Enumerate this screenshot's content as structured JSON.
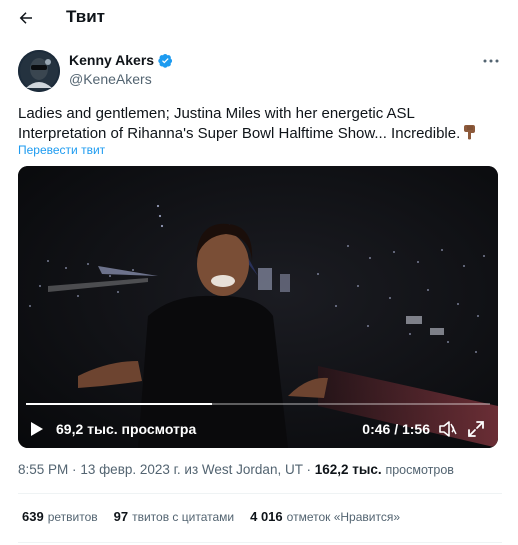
{
  "header": {
    "title": "Твит"
  },
  "author": {
    "name": "Kenny Akers",
    "handle": "@KeneAkers",
    "verified": true
  },
  "tweet": {
    "text": "Ladies and gentlemen; Justina Miles with her energetic ASL Interpretation of Rihanna's Super Bowl Halftime Show... Incredible.",
    "translate_label": "Перевести твит"
  },
  "video": {
    "views_label": "69,2 тыс. просмотра",
    "time_label": "0:46 / 1:56",
    "progress": 0.4
  },
  "meta": {
    "time": "8:55 PM",
    "sep1": "·",
    "date": "13 февр. 2023 г. из West Jordan, UT",
    "sep2": "·",
    "views_count": "162,2 тыс.",
    "views_word": "просмотров"
  },
  "stats": {
    "retweets_count": "639",
    "retweets_label": "ретвитов",
    "quotes_count": "97",
    "quotes_label": "твитов с цитатами",
    "likes_count": "4 016",
    "likes_label": "отметок «Нравится»"
  },
  "colors": {
    "text": "#0f1419",
    "secondary": "#536471",
    "link": "#1d9bf0",
    "verified": "#1d9bf0"
  }
}
